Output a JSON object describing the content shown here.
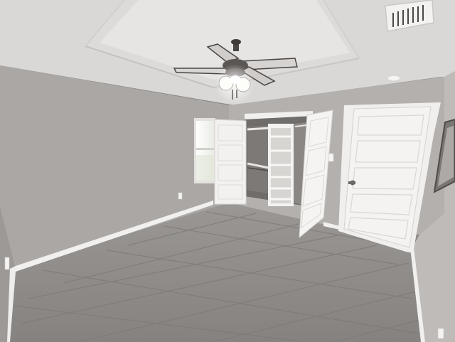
{
  "scene": {
    "kind": "photo",
    "subject": "empty-bedroom-interior",
    "colors": {
      "ceiling": "#d9d8d6",
      "tray_ceiling": "#e4e3e1",
      "wall_left": "#a9a6a4",
      "wall_back": "#b1aeab",
      "wall_right": "#bdbab7",
      "floor": "#8e8b89",
      "grout": "#7a7775",
      "trim": "#f2f1ef",
      "door": "#f4f3f1",
      "closet_interior": "#6f6c6a",
      "window_light": "#f7f7f2",
      "fan_metal": "#4a4644",
      "fan_glow": "#fbfbf7"
    },
    "icons": [
      "ceiling-fan-icon",
      "air-vent-icon",
      "smoke-detector-icon",
      "light-switch-icon",
      "outlet-icon",
      "door-knob-icon"
    ]
  }
}
